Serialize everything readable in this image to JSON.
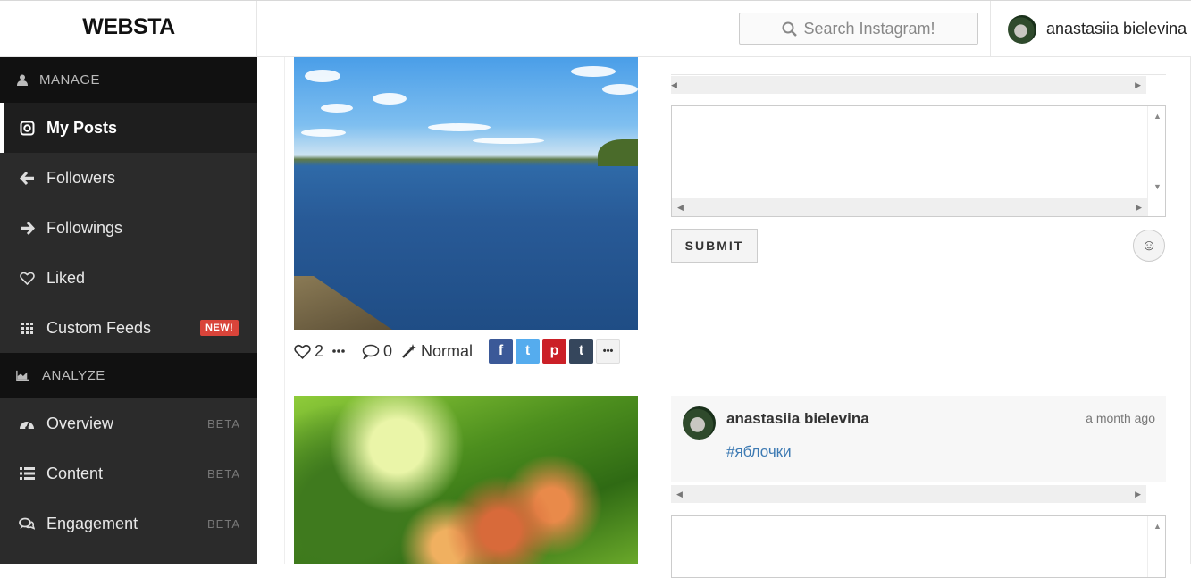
{
  "app": {
    "logo": "WEBSTA"
  },
  "search": {
    "placeholder": "Search Instagram!"
  },
  "user": {
    "name": "anastasiia bielevina"
  },
  "sidebar": {
    "manage_label": "MANAGE",
    "analyze_label": "ANALYZE",
    "manage_items": [
      {
        "label": "My Posts",
        "icon": "instagram-icon",
        "active": true
      },
      {
        "label": "Followers",
        "icon": "arrow-left-icon"
      },
      {
        "label": "Followings",
        "icon": "arrow-right-icon"
      },
      {
        "label": "Liked",
        "icon": "heart-icon"
      },
      {
        "label": "Custom Feeds",
        "icon": "grid-icon",
        "badge": "NEW!"
      }
    ],
    "analyze_items": [
      {
        "label": "Overview",
        "icon": "dashboard-icon",
        "badge": "BETA"
      },
      {
        "label": "Content",
        "icon": "list-icon",
        "badge": "BETA"
      },
      {
        "label": "Engagement",
        "icon": "comments-icon",
        "badge": "BETA"
      }
    ]
  },
  "post1": {
    "likes": "2",
    "comments": "0",
    "filter": "Normal",
    "share": {
      "facebook": "f",
      "twitter": "t",
      "pinterest": "p",
      "tumblr": "t",
      "more": "•••"
    }
  },
  "composer": {
    "submit_label": "SUBMIT",
    "emoji": "☺"
  },
  "post2": {
    "comment": {
      "user": "anastasiia bielevina",
      "time": "a month ago",
      "text": "#яблочки"
    }
  },
  "colors": {
    "sidebar_bg": "#2b2b2b",
    "section_bg": "#111111",
    "new_badge": "#d9443a",
    "link": "#3d7ab3"
  }
}
